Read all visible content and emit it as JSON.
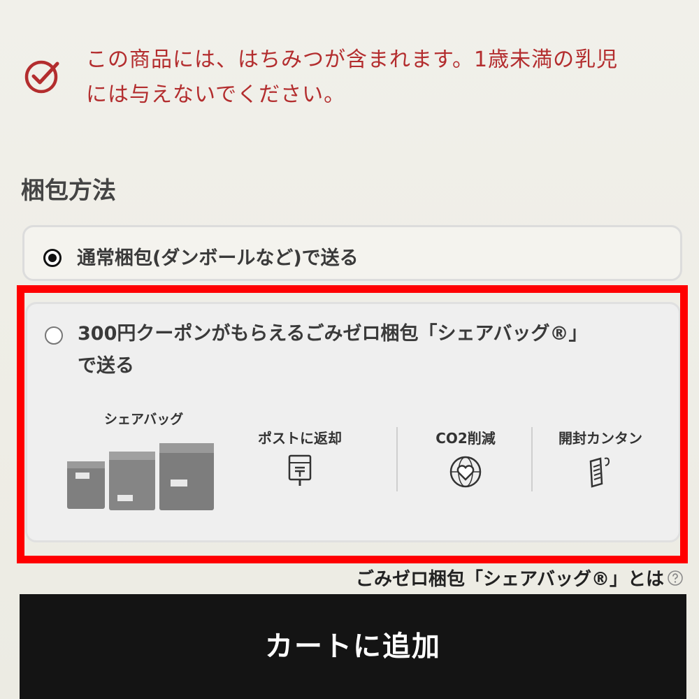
{
  "notice": {
    "line1": "この商品には、はちみつが含まれます。1歳未満の乳児",
    "line2": "には与えないでください。"
  },
  "packaging": {
    "title": "梱包方法",
    "options": [
      {
        "label": "通常梱包(ダンボールなど)で送る",
        "selected": true
      },
      {
        "label_line1": "300円クーポンがもらえるごみゼロ梱包「シェアバッグ®」",
        "label_line2": "で送る",
        "selected": false
      }
    ]
  },
  "sharebag": {
    "caption": "シェアバッグ",
    "features": [
      {
        "label": "ポストに返却",
        "icon": "mailbox-icon"
      },
      {
        "label": "CO2削減",
        "icon": "globe-heart-icon"
      },
      {
        "label": "開封カンタン",
        "icon": "open-bag-icon"
      }
    ]
  },
  "about_link": "ごみゼロ梱包「シェアバッグ®」とは",
  "cart_button": "カートに追加",
  "colors": {
    "notice_red": "#b32d2e",
    "highlight_red": "#ff0000",
    "button_bg": "#141414"
  }
}
